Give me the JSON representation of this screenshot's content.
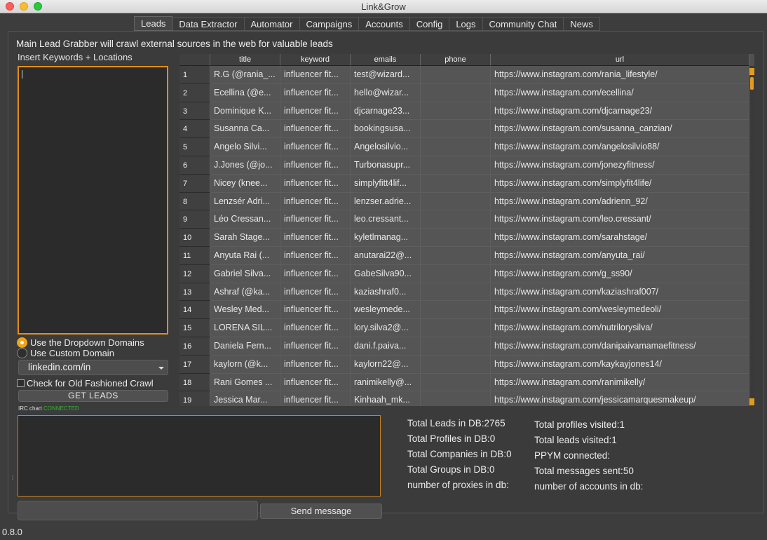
{
  "window": {
    "title": "Link&Grow"
  },
  "tabs": [
    {
      "label": "Leads",
      "active": true
    },
    {
      "label": "Data Extractor"
    },
    {
      "label": "Automator"
    },
    {
      "label": "Campaigns"
    },
    {
      "label": "Accounts"
    },
    {
      "label": "Config"
    },
    {
      "label": "Logs"
    },
    {
      "label": "Community Chat"
    },
    {
      "label": "News"
    }
  ],
  "leads": {
    "intro": "Main Lead Grabber will crawl external sources in the web for valuable leads",
    "keywords_label": "Insert Keywords + Locations",
    "keywords_value": "",
    "radio_dropdown": "Use the Dropdown Domains",
    "radio_custom": "Use Custom Domain",
    "domain_selected": "linkedin.com/in",
    "old_crawl": "Check for Old Fashioned Crawl",
    "get_leads": "GET LEADS",
    "irc_label": "IRC chart",
    "irc_status": "CONNECTED",
    "send_message": "Send message"
  },
  "table": {
    "columns": [
      "",
      "title",
      "keyword",
      "emails",
      "phone",
      "url"
    ],
    "rows": [
      [
        "1",
        "R.G (@rania_...",
        "influencer fit...",
        "test@wizard...",
        "",
        "https://www.instagram.com/rania_lifestyle/"
      ],
      [
        "2",
        "Ecellina (@e...",
        "influencer fit...",
        "hello@wizar...",
        "",
        "https://www.instagram.com/ecellina/"
      ],
      [
        "3",
        "Dominique K...",
        "influencer fit...",
        "djcarnage23...",
        "",
        "https://www.instagram.com/djcarnage23/"
      ],
      [
        "4",
        "Susanna Ca...",
        "influencer fit...",
        "bookingsusa...",
        "",
        "https://www.instagram.com/susanna_canzian/"
      ],
      [
        "5",
        "Angelo Silvi...",
        "influencer fit...",
        "Angelosilvio...",
        "",
        "https://www.instagram.com/angelosilvio88/"
      ],
      [
        "6",
        "J.Jones (@jo...",
        "influencer fit...",
        "Turbonasupr...",
        "",
        "https://www.instagram.com/jonezyfitness/"
      ],
      [
        "7",
        "Nicey (knee...",
        "influencer fit...",
        "simplyfitt4lif...",
        "",
        "https://www.instagram.com/simplyfit4life/"
      ],
      [
        "8",
        "Lenzsér Adri...",
        "influencer fit...",
        "lenzser.adrie...",
        "",
        "https://www.instagram.com/adrienn_92/"
      ],
      [
        "9",
        "Léo Cressan...",
        "influencer fit...",
        "leo.cressant...",
        "",
        "https://www.instagram.com/leo.cressant/"
      ],
      [
        "10",
        "Sarah Stage...",
        "influencer fit...",
        "kyletlmanag...",
        "",
        "https://www.instagram.com/sarahstage/"
      ],
      [
        "11",
        "Anyuta Rai (...",
        "influencer fit...",
        "anutarai22@...",
        "",
        "https://www.instagram.com/anyuta_rai/"
      ],
      [
        "12",
        "Gabriel Silva...",
        "influencer fit...",
        "GabeSilva90...",
        "",
        "https://www.instagram.com/g_ss90/"
      ],
      [
        "13",
        "Ashraf (@ka...",
        "influencer fit...",
        "kaziashraf0...",
        "",
        "https://www.instagram.com/kaziashraf007/"
      ],
      [
        "14",
        "Wesley Med...",
        "influencer fit...",
        "wesleymede...",
        "",
        "https://www.instagram.com/wesleymedeoli/"
      ],
      [
        "15",
        "LORENA SIL...",
        "influencer fit...",
        "lory.silva2@...",
        "",
        "https://www.instagram.com/nutrilorysilva/"
      ],
      [
        "16",
        "Daniela Fern...",
        "influencer fit...",
        "dani.f.paiva...",
        "",
        "https://www.instagram.com/danipaivamamaefitness/"
      ],
      [
        "17",
        "kaylorn (@k...",
        "influencer fit...",
        "kaylorn22@...",
        "",
        "https://www.instagram.com/kaykayjones14/"
      ],
      [
        "18",
        "Rani Gomes ...",
        "influencer fit...",
        "ranimikelly@...",
        "",
        "https://www.instagram.com/ranimikelly/"
      ],
      [
        "19",
        "Jessica Mar...",
        "influencer fit...",
        "Kinhaah_mk...",
        "",
        "https://www.instagram.com/jessicamarquesmakeup/"
      ]
    ]
  },
  "stats_left": [
    "Total Leads in DB:2765",
    "Total Profiles in DB:0",
    "Total Companies in DB:0",
    "Total Groups in DB:0",
    "number of proxies in db:"
  ],
  "stats_right": [
    "Total profiles visited:1",
    "Total leads visited:1",
    "PPYM connected:",
    "Total messages sent:50",
    "number of accounts in db:"
  ],
  "version": "0.8.0"
}
